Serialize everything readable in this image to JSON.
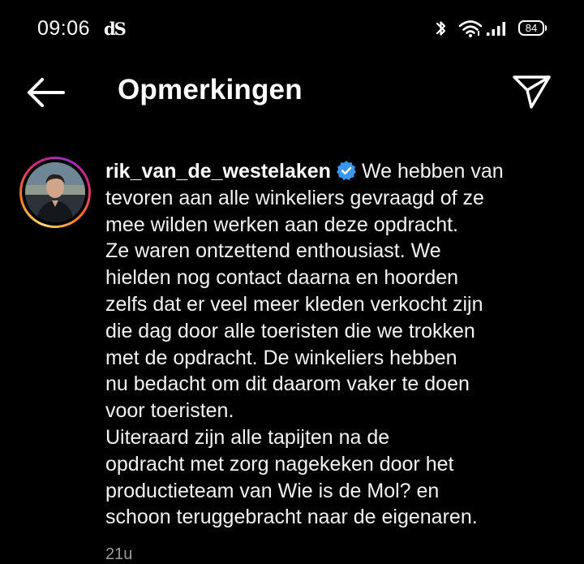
{
  "status_bar": {
    "time": "09:06",
    "app_icon": "dS",
    "battery": "84",
    "icons": [
      "bluetooth-icon",
      "wifi-icon",
      "signal-icon",
      "battery-icon"
    ]
  },
  "header": {
    "title": "Opmerkingen",
    "back_icon": "arrow-left-icon",
    "share_icon": "paper-plane-icon"
  },
  "comment": {
    "username": "rik_van_de_westelaken",
    "verified": true,
    "lines": [
      "We hebben van",
      "tevoren aan alle winkeliers gevraagd of ze",
      "mee wilden werken aan deze opdracht.",
      "Ze waren ontzettend enthousiast. We",
      "hielden nog contact daarna en hoorden",
      "zelfs dat er veel meer kleden verkocht zijn",
      "die dag door alle toeristen die we trokken",
      "met de opdracht. De winkeliers hebben",
      "nu bedacht om dit daarom vaker te doen",
      "voor toeristen.",
      "Uiteraard zijn alle tapijten na de",
      "opdracht met zorg nagekeken door het",
      "productieteam van Wie is de Mol? en",
      "schoon teruggebracht naar de eigenaren."
    ],
    "timestamp": "21u"
  },
  "colors": {
    "background": "#000000",
    "text": "#f2f2f2",
    "verified": "#3897f0",
    "muted": "#9a9a9a"
  }
}
